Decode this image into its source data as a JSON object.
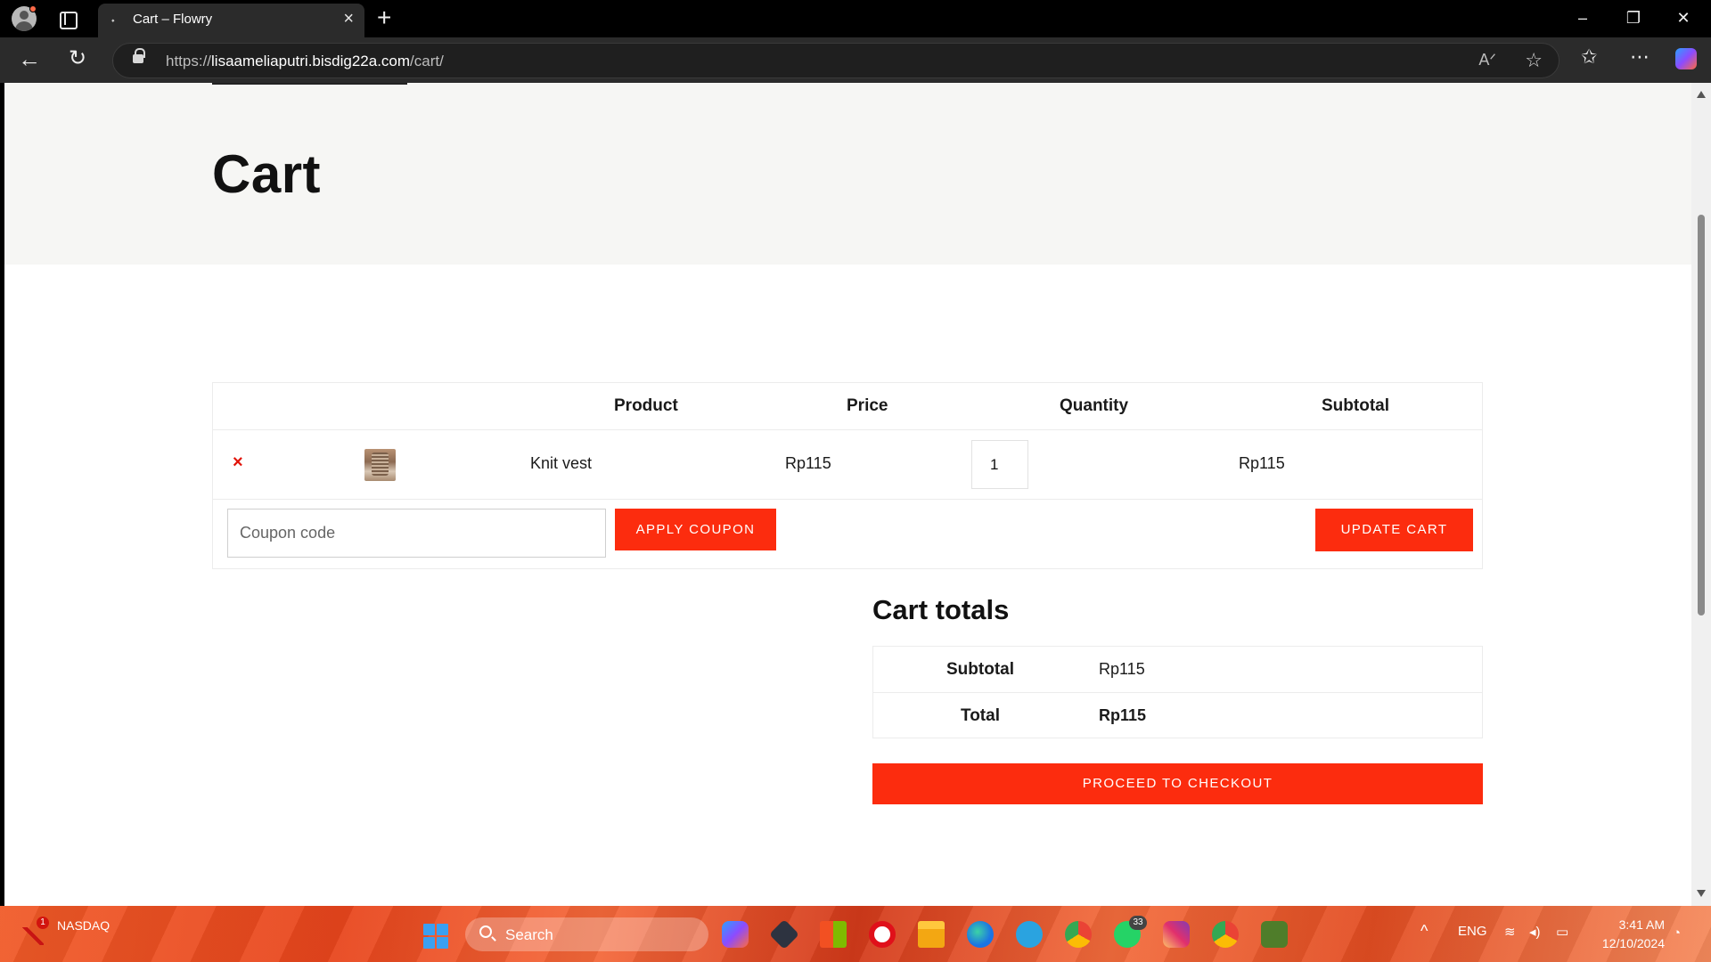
{
  "browser": {
    "tab_title": "Cart – Flowry",
    "url_prefix": "https://",
    "url_host": "lisaameliaputri.bisdig22a.com",
    "url_path": "/cart/",
    "icons": [
      "profile-icon",
      "tab-actions-icon",
      "close-icon",
      "new-tab-icon",
      "back-icon",
      "reload-icon",
      "lock-icon",
      "read-aloud-icon",
      "favorite-star-icon",
      "favorites-icon",
      "more-icon",
      "copilot-icon"
    ]
  },
  "page": {
    "title": "Cart",
    "table": {
      "headers": [
        "Product",
        "Price",
        "Quantity",
        "Subtotal"
      ],
      "items": [
        {
          "name": "Knit vest",
          "price": "Rp115",
          "quantity": "1",
          "subtotal": "Rp115"
        }
      ],
      "remove_symbol": "×"
    },
    "coupon": {
      "placeholder": "Coupon code",
      "apply_label": "APPLY COUPON"
    },
    "update_label": "UPDATE CART",
    "totals": {
      "heading": "Cart totals",
      "subtotal_label": "Subtotal",
      "subtotal_value": "Rp115",
      "total_label": "Total",
      "total_value": "Rp115"
    },
    "checkout_label": "PROCEED TO CHECKOUT",
    "accent_color": "#fc2c0e"
  },
  "taskbar": {
    "stock_name": "NASDAQ",
    "stock_badge": "1",
    "search_label": "Search",
    "whatsapp_badge": "33",
    "language": "ENG",
    "time": "3:41 AM",
    "date": "12/10/2024"
  }
}
